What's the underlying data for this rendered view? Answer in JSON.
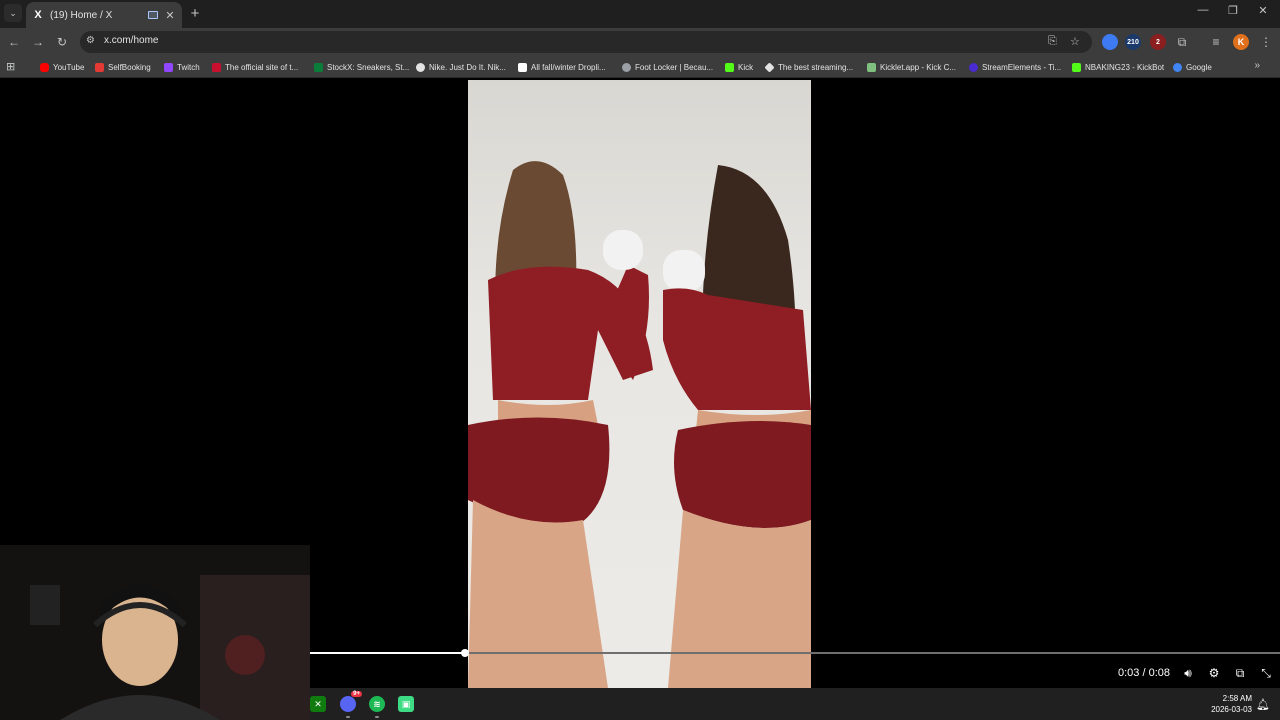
{
  "browser": {
    "tab": {
      "title": "(19) Home / X",
      "favicon": "X"
    },
    "address": {
      "url": "x.com/home"
    },
    "profile_initial": "K",
    "extension_badges": {
      "counter_a": "210",
      "counter_b": "2"
    }
  },
  "bookmarks": [
    {
      "label": "YouTube",
      "color": "#ff0000"
    },
    {
      "label": "SelfBooking",
      "color": "#e53935"
    },
    {
      "label": "Twitch",
      "color": "#9146ff"
    },
    {
      "label": "The official site of t...",
      "color": "#c8102e"
    },
    {
      "label": "StockX: Sneakers, St...",
      "color": "#0a7d3b"
    },
    {
      "label": "Nike. Just Do It. Nik...",
      "color": "#e3e3e3"
    },
    {
      "label": "All fall/winter Dropli...",
      "color": "#ffffff"
    },
    {
      "label": "Foot Locker | Becau...",
      "color": "#9aa0a6"
    },
    {
      "label": "Kick",
      "color": "#53fc18"
    },
    {
      "label": "The best streaming...",
      "color": "#e3e3e3"
    },
    {
      "label": "Kicklet.app - Kick C...",
      "color": "#7fbf7f"
    },
    {
      "label": "StreamElements - Ti...",
      "color": "#4a2bd1"
    },
    {
      "label": "NBAKING23 - KickBot",
      "color": "#53fc18"
    },
    {
      "label": "Google",
      "color": "#4285f4"
    }
  ],
  "video": {
    "current_time": "0:03",
    "duration": "0:08",
    "time_label": "0:03 / 0:08",
    "progress": 0.16
  },
  "taskbar": {
    "apps": [
      "xbox-icon",
      "discord-icon",
      "spotify-icon",
      "android-icon"
    ],
    "discord_badge": "9+",
    "time": "2:58 AM",
    "date": "2026-03-03"
  }
}
